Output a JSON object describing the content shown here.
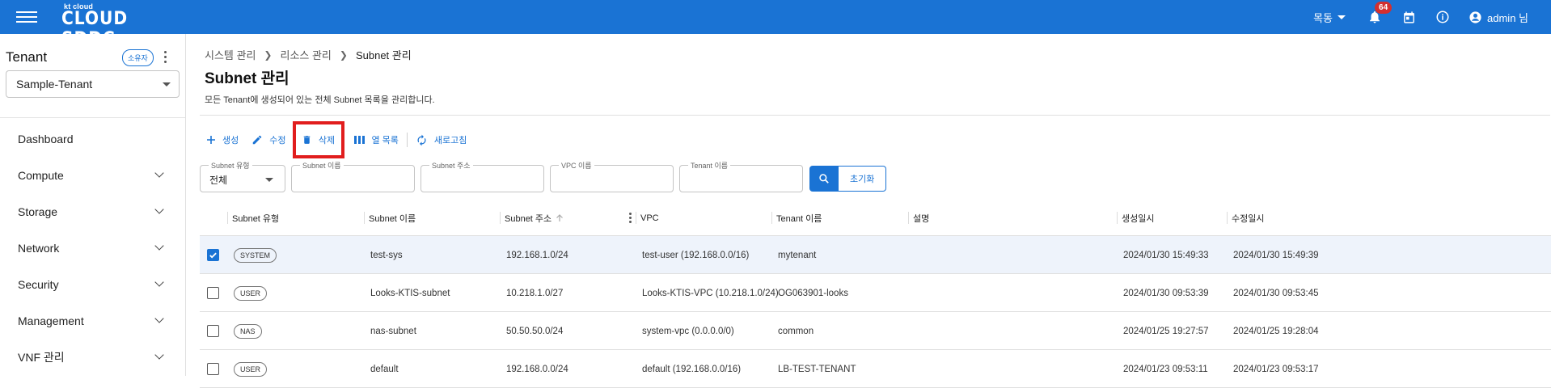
{
  "header": {
    "logo_small": "kt cloud",
    "logo_big": "CLOUD SDDC",
    "region": "목동",
    "notification_count": "64",
    "user": "admin 님"
  },
  "sidebar": {
    "tenant_title": "Tenant",
    "owner_chip": "소유자",
    "tenant_value": "Sample-Tenant",
    "items": [
      {
        "label": "Dashboard"
      },
      {
        "label": "Compute"
      },
      {
        "label": "Storage"
      },
      {
        "label": "Network"
      },
      {
        "label": "Security"
      },
      {
        "label": "Management"
      },
      {
        "label": "VNF 관리"
      }
    ]
  },
  "breadcrumb": [
    "시스템 관리",
    "리소스 관리",
    "Subnet 관리"
  ],
  "page": {
    "title": "Subnet 관리",
    "description": "모든 Tenant에 생성되어 있는 전체 Subnet 목록을 관리합니다."
  },
  "toolbar": {
    "create": "생성",
    "edit": "수정",
    "delete": "삭제",
    "columns": "열 목록",
    "refresh": "새로고침"
  },
  "filters": {
    "type_label": "Subnet 유형",
    "type_value": "전체",
    "name_label": "Subnet 이름",
    "address_label": "Subnet 주소",
    "vpc_label": "VPC 이름",
    "tenant_label": "Tenant 이름",
    "reset": "초기화"
  },
  "table": {
    "columns": [
      "Subnet 유형",
      "Subnet 이름",
      "Subnet 주소",
      "VPC",
      "Tenant 이름",
      "설명",
      "생성일시",
      "수정일시"
    ],
    "rows": [
      {
        "checked": true,
        "type": "SYSTEM",
        "name": "test-sys",
        "address": "192.168.1.0/24",
        "vpc": "test-user (192.168.0.0/16)",
        "tenant": "mytenant",
        "desc": "",
        "created": "2024/01/30 15:49:33",
        "modified": "2024/01/30 15:49:39"
      },
      {
        "checked": false,
        "type": "USER",
        "name": "Looks-KTIS-subnet",
        "address": "10.218.1.0/27",
        "vpc": "Looks-KTIS-VPC (10.218.1.0/24)",
        "tenant": "OG063901-looks",
        "desc": "",
        "created": "2024/01/30 09:53:39",
        "modified": "2024/01/30 09:53:45"
      },
      {
        "checked": false,
        "type": "NAS",
        "name": "nas-subnet",
        "address": "50.50.50.0/24",
        "vpc": "system-vpc (0.0.0.0/0)",
        "tenant": "common",
        "desc": "",
        "created": "2024/01/25 19:27:57",
        "modified": "2024/01/25 19:28:04"
      },
      {
        "checked": false,
        "type": "USER",
        "name": "default",
        "address": "192.168.0.0/24",
        "vpc": "default (192.168.0.0/16)",
        "tenant": "LB-TEST-TENANT",
        "desc": "",
        "created": "2024/01/23 09:53:11",
        "modified": "2024/01/23 09:53:17"
      }
    ]
  },
  "colors": {
    "brand": "#1a73d4",
    "highlight": "#e11d1d",
    "badge": "#d32f2f"
  }
}
